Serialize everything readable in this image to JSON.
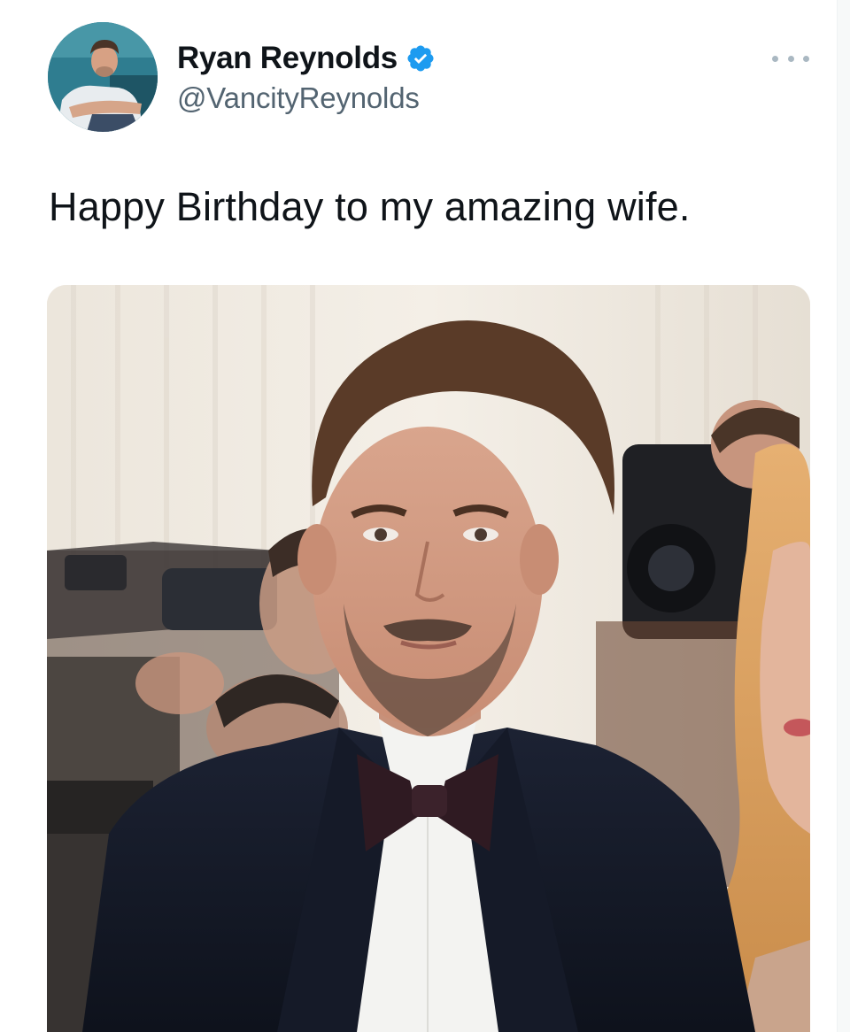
{
  "tweet": {
    "author": {
      "display_name": "Ryan Reynolds",
      "handle": "@VancityReynolds",
      "verified": true,
      "avatar_icon": "profile-photo"
    },
    "more_icon": "more-options-icon",
    "text": "Happy Birthday to my amazing wife.",
    "media": {
      "type": "photo"
    }
  },
  "colors": {
    "name_text": "#0f1419",
    "handle_text": "#536471",
    "verified_badge": "#1d9bf0",
    "more_dots": "#aab8c2"
  }
}
